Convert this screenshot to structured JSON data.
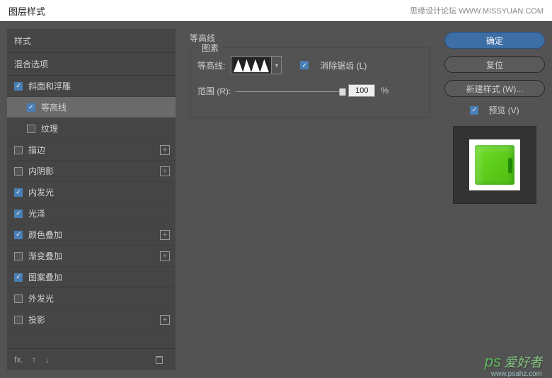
{
  "title_bar": {
    "title": "图层样式",
    "brand": "思缘设计论坛 WWW.MISSYUAN.COM"
  },
  "left": {
    "header": "样式",
    "blend": "混合选项",
    "items": [
      {
        "label": "斜面和浮雕",
        "checked": true,
        "has_add": false,
        "sub": false
      },
      {
        "label": "等高线",
        "checked": true,
        "has_add": false,
        "sub": true,
        "selected": true
      },
      {
        "label": "纹理",
        "checked": false,
        "has_add": false,
        "sub": true
      },
      {
        "label": "描边",
        "checked": false,
        "has_add": true,
        "sub": false
      },
      {
        "label": "内阴影",
        "checked": false,
        "has_add": true,
        "sub": false
      },
      {
        "label": "内发光",
        "checked": true,
        "has_add": false,
        "sub": false
      },
      {
        "label": "光泽",
        "checked": true,
        "has_add": false,
        "sub": false
      },
      {
        "label": "颜色叠加",
        "checked": true,
        "has_add": true,
        "sub": false
      },
      {
        "label": "渐变叠加",
        "checked": false,
        "has_add": true,
        "sub": false
      },
      {
        "label": "图案叠加",
        "checked": true,
        "has_add": false,
        "sub": false
      },
      {
        "label": "外发光",
        "checked": false,
        "has_add": false,
        "sub": false
      },
      {
        "label": "投影",
        "checked": false,
        "has_add": true,
        "sub": false
      }
    ]
  },
  "main": {
    "section_title": "等高线",
    "fieldset_label": "图素",
    "contour_label": "等高线:",
    "antialias_label": "消除锯齿 (L)",
    "antialias_checked": true,
    "range_label": "范围 (R):",
    "range_value": "100",
    "range_unit": "%"
  },
  "right": {
    "ok": "确定",
    "reset": "复位",
    "new_style": "新建样式 (W)...",
    "preview_label": "预览 (V)",
    "preview_checked": true
  },
  "watermark": {
    "logo": "ps",
    "cn": "爱好者",
    "url": "www.psahz.com"
  }
}
